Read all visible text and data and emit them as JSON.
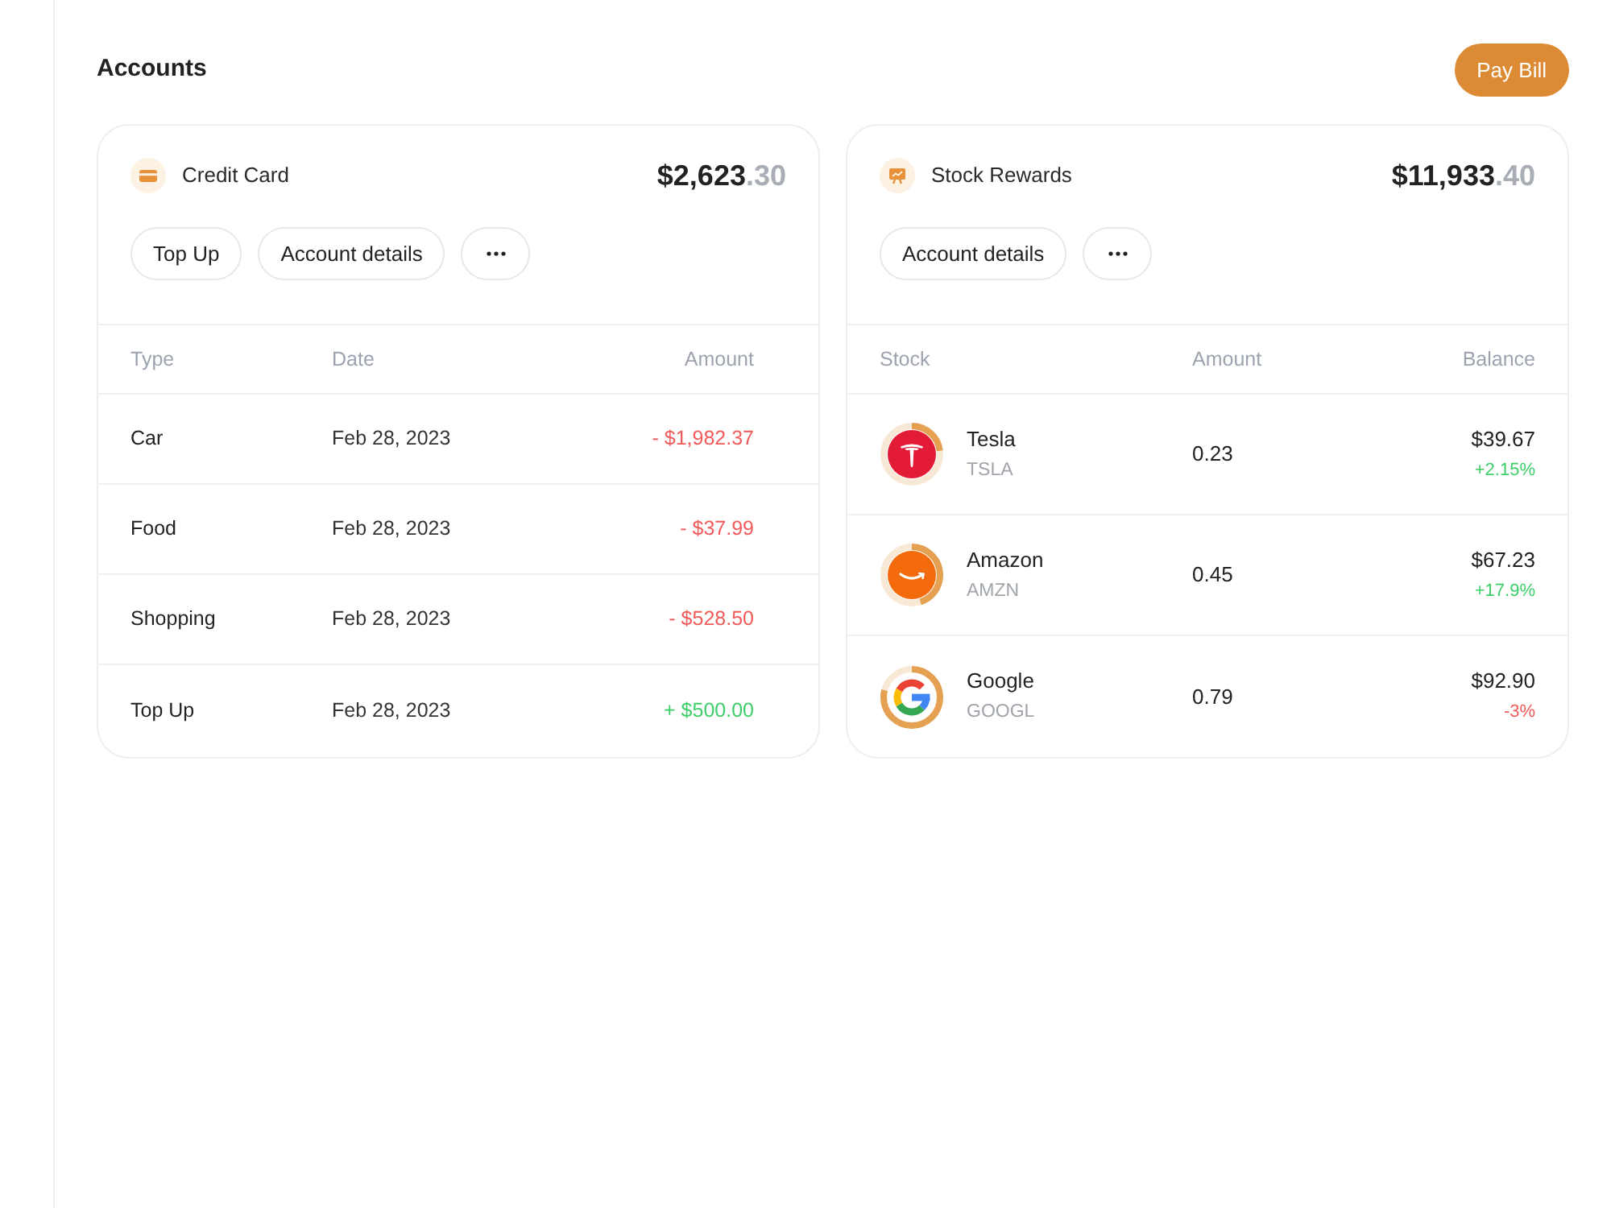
{
  "page": {
    "title": "Accounts",
    "pay_button": "Pay Bill"
  },
  "credit_card": {
    "title": "Credit Card",
    "balance": "$2,623",
    "balance_cents": ".30",
    "buttons": [
      "Top Up",
      "Account details"
    ],
    "columns": [
      "Type",
      "Date",
      "Amount"
    ],
    "rows": [
      {
        "type": "Car",
        "date": "Feb 28, 2023",
        "amount": "- $1,982.37",
        "positive": false
      },
      {
        "type": "Food",
        "date": "Feb 28, 2023",
        "amount": "- $37.99",
        "positive": false
      },
      {
        "type": "Shopping",
        "date": "Feb 28, 2023",
        "amount": "- $528.50",
        "positive": false
      },
      {
        "type": "Top Up",
        "date": "Feb 28, 2023",
        "amount": "+ $500.00",
        "positive": true
      }
    ]
  },
  "stock_rewards": {
    "title": "Stock Rewards",
    "balance": "$11,933",
    "balance_cents": ".40",
    "buttons": [
      "Account details"
    ],
    "columns": [
      "Stock",
      "Amount",
      "Balance"
    ],
    "rows": [
      {
        "kind": "tesla",
        "name": "Tesla",
        "ticker": "TSLA",
        "level": 0.23,
        "amount": "0.23",
        "balance": "$39.67",
        "change": "+2.15%",
        "positive": true
      },
      {
        "kind": "amazon",
        "name": "Amazon",
        "ticker": "AMZN",
        "level": 0.45,
        "amount": "0.45",
        "balance": "$67.23",
        "change": "+17.9%",
        "positive": true
      },
      {
        "kind": "google",
        "name": "Google",
        "ticker": "GOOGL",
        "level": 0.79,
        "amount": "0.79",
        "balance": "$92.90",
        "change": "-3%",
        "positive": false
      }
    ]
  }
}
